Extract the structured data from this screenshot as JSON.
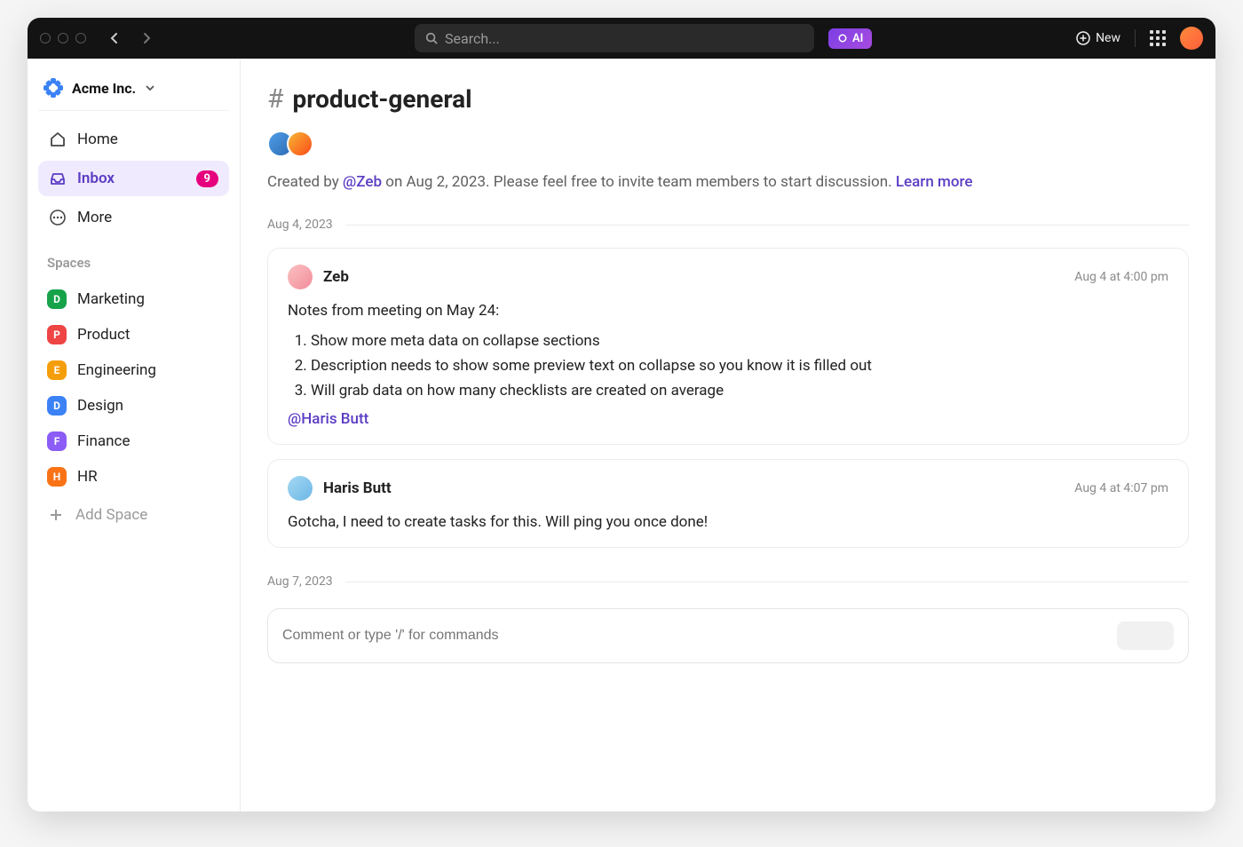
{
  "titlebar": {
    "search_placeholder": "Search...",
    "ai_label": "AI",
    "new_label": "New"
  },
  "workspace": {
    "name": "Acme Inc."
  },
  "nav": {
    "home": "Home",
    "inbox": "Inbox",
    "inbox_badge": "9",
    "more": "More"
  },
  "sidebar": {
    "section": "Spaces",
    "spaces": [
      {
        "letter": "D",
        "label": "Marketing",
        "color": "#16a34a"
      },
      {
        "letter": "P",
        "label": "Product",
        "color": "#ef4444"
      },
      {
        "letter": "E",
        "label": "Engineering",
        "color": "#f59e0b"
      },
      {
        "letter": "D",
        "label": "Design",
        "color": "#3b82f6"
      },
      {
        "letter": "F",
        "label": "Finance",
        "color": "#8b5cf6"
      },
      {
        "letter": "H",
        "label": "HR",
        "color": "#f97316"
      }
    ],
    "add_space": "Add Space"
  },
  "channel": {
    "name": "product-general",
    "created_prefix": "Created by ",
    "created_by": "@Zeb",
    "created_mid": " on Aug 2, 2023. Please feel free to invite team members to start discussion. ",
    "learn_more": "Learn more"
  },
  "thread": {
    "date1": "Aug 4, 2023",
    "date2": "Aug 7, 2023",
    "messages": [
      {
        "author": "Zeb",
        "time": "Aug 4 at 4:00 pm",
        "intro": "Notes from meeting on May 24:",
        "items": [
          "Show more meta data on collapse sections",
          "Description needs to show some preview text on collapse so you know it is filled out",
          "Will grab data on how many checklists are created on average"
        ],
        "mention": "@Haris Butt"
      },
      {
        "author": "Haris Butt",
        "time": "Aug 4 at 4:07 pm",
        "text": "Gotcha, I need to create tasks for this. Will ping you once done!"
      }
    ]
  },
  "composer": {
    "placeholder": "Comment or type '/' for commands"
  }
}
